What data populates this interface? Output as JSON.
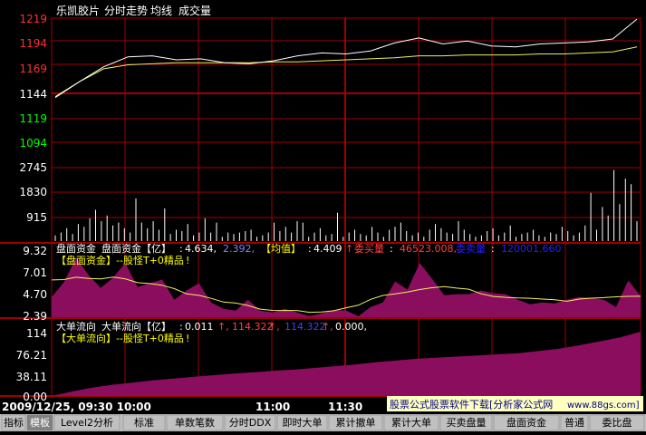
{
  "header": {
    "title": "乐凯胶片",
    "view": "分时走势",
    "avg_label": "均线",
    "vol_label": "成交量"
  },
  "price_axis": {
    "ticks": [
      "1219",
      "1194",
      "1169",
      "1144",
      "1119",
      "1094"
    ],
    "tick_colors": [
      "#ff3030",
      "#ff3030",
      "#ff3030",
      "#ffffff",
      "#00ff00",
      "#00ff00"
    ]
  },
  "volume_axis": {
    "ticks": [
      "2745",
      "1830",
      "915"
    ]
  },
  "panel_pan": {
    "line1": {
      "name": "盘面资金",
      "fn": "盘面资金【亿】",
      "colon": ":",
      "v1": "4.634,",
      "v2": "2.392,",
      "avg_label": "【均值】",
      "v3": "4.409",
      "arrow": "↑",
      "buy_label": "委买量",
      "buy_value": "46523.008,",
      "sell_label": "委卖量",
      "sell_value": "120001.660"
    },
    "line2": "【盘面资金】--股怪T+0精品",
    "line2_mark": "!",
    "ticks": [
      "9.32",
      "7.01",
      "4.70",
      "2.39"
    ]
  },
  "panel_big": {
    "line1": {
      "name": "大单流向",
      "fn": "大单流向【亿】",
      "colon": ":",
      "v1": "0.011",
      "a1": "↑,",
      "v2": "114.322",
      "a2": "↑,",
      "v3": "114.322",
      "a3": "↑,",
      "v4": "0.000,"
    },
    "line2": "【大单流向】--股怪T+0精品",
    "line2_mark": "!",
    "ticks": [
      "114",
      "76.21",
      "38.11",
      "0.00"
    ]
  },
  "time_axis": {
    "start": "2009/12/25, 09:30 10:00",
    "t1100": "11:00",
    "t1130": "11:30"
  },
  "watermark": {
    "text": "股票公式股票软件下载",
    "bracket": "[分析家公式网",
    "url": "www.88gs.com]"
  },
  "tabs": [
    "指标",
    "模板",
    "Level2分析",
    "标准",
    "单数笔数",
    "分时DDX",
    "即时大单",
    "累计撤单",
    "累计大单",
    "买卖盘量",
    "盘面资金",
    "普通",
    "委比盘"
  ],
  "active_tab": 1,
  "colors": {
    "grid": "#a00000",
    "price": "#ffffff",
    "avg": "#f0f060",
    "magenta": "#8b0d5e",
    "title_bg": "#ffffc0",
    "bar_bg": "#c0c0c0"
  },
  "chart_data": [
    {
      "type": "line",
      "title": "分时走势",
      "series": [
        {
          "name": "分时走势",
          "x": [
            "09:30",
            "09:40",
            "09:50",
            "10:00",
            "10:10",
            "10:20",
            "10:30",
            "10:40",
            "10:50",
            "11:00",
            "11:10",
            "11:20",
            "11:30",
            "13:10",
            "13:20",
            "13:30",
            "13:40",
            "13:50",
            "14:00",
            "14:10",
            "14:20",
            "14:30",
            "14:40",
            "14:50",
            "15:00"
          ],
          "values": [
            1139,
            1155,
            1170,
            1180,
            1181,
            1177,
            1178,
            1174,
            1173,
            1176,
            1181,
            1184,
            1183,
            1186,
            1194,
            1199,
            1193,
            1196,
            1191,
            1190,
            1193,
            1194,
            1195,
            1198,
            1218
          ]
        },
        {
          "name": "均线",
          "x": [
            "09:30",
            "09:40",
            "09:50",
            "10:00",
            "10:10",
            "10:20",
            "10:30",
            "10:40",
            "10:50",
            "11:00",
            "11:10",
            "11:20",
            "11:30",
            "13:10",
            "13:20",
            "13:30",
            "13:40",
            "13:50",
            "14:00",
            "14:10",
            "14:20",
            "14:30",
            "14:40",
            "14:50",
            "15:00"
          ],
          "values": [
            1140,
            1155,
            1168,
            1172,
            1173,
            1174,
            1174,
            1174,
            1174,
            1175,
            1175,
            1176,
            1177,
            1178,
            1179,
            1181,
            1181,
            1182,
            1182,
            1182,
            1183,
            1183,
            1184,
            1185,
            1190
          ]
        }
      ],
      "ylim": [
        1094,
        1219
      ]
    },
    {
      "type": "bar",
      "title": "成交量",
      "ylim": [
        0,
        2745
      ],
      "values": [
        200,
        300,
        450,
        250,
        600,
        500,
        800,
        1100,
        700,
        900,
        550,
        650,
        450,
        300,
        1500,
        650,
        450,
        700,
        400,
        1150,
        250,
        400,
        350,
        600,
        200,
        300,
        800,
        300,
        650,
        150,
        300,
        250,
        300,
        350,
        400,
        150,
        200,
        300,
        650,
        350,
        500,
        300,
        700,
        650,
        150,
        300,
        450,
        200,
        250,
        1000,
        150,
        300,
        400,
        250,
        200,
        500,
        300,
        150,
        400,
        500,
        650,
        350,
        200,
        300,
        150,
        400,
        600,
        450,
        300,
        250,
        700,
        400,
        250,
        150,
        200,
        350,
        450,
        200,
        300,
        550,
        150,
        250,
        300,
        400,
        200,
        150,
        300,
        250,
        500,
        350,
        200,
        300,
        550,
        1700,
        400,
        1200,
        900,
        2500,
        1300,
        2200,
        2000,
        700
      ]
    },
    {
      "type": "area",
      "title": "盘面资金",
      "ylim": [
        2.39,
        9.32
      ],
      "values": [
        4.6,
        6.2,
        8.9,
        7.0,
        5.6,
        6.7,
        8.3,
        5.7,
        6.1,
        6.5,
        4.3,
        5.3,
        6.1,
        4.0,
        3.3,
        3.1,
        4.3,
        3.1,
        2.9,
        3.3,
        2.9,
        2.5,
        2.8,
        3.2,
        3.1,
        2.5,
        3.5,
        4.0,
        6.3,
        5.4,
        8.3,
        6.6,
        4.8,
        4.9,
        4.9,
        5.3,
        5.0,
        4.9,
        4.3,
        3.8,
        4.0,
        3.9,
        4.3,
        4.6,
        4.5,
        4.3,
        3.5,
        6.4,
        4.7
      ]
    },
    {
      "type": "area",
      "title": "大单流向",
      "ylim": [
        0,
        114
      ],
      "values": [
        0,
        8,
        15,
        20,
        24,
        28,
        31,
        34,
        37,
        40,
        42,
        45,
        47,
        50,
        53,
        56,
        60,
        63,
        66,
        68,
        70,
        72,
        74,
        76,
        80,
        84,
        90,
        97,
        104,
        114
      ]
    }
  ]
}
